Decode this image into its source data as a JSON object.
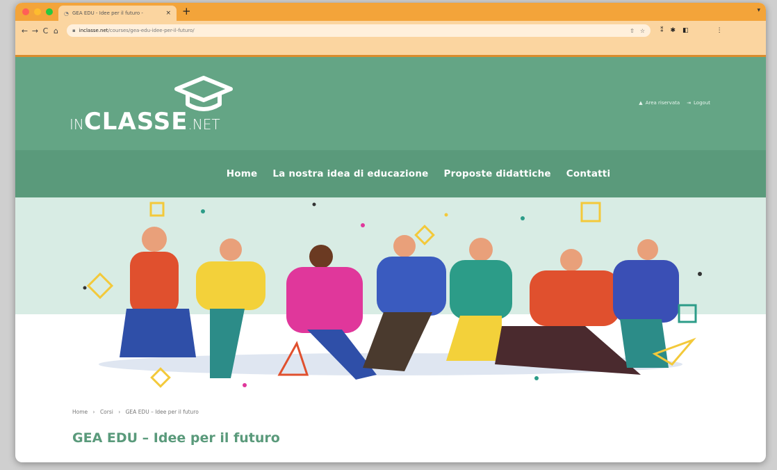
{
  "browser": {
    "tab_title": "GEA EDU - Idee per il futuro -",
    "url_domain": "inclasse.net",
    "url_path": "/courses/gea-edu-idee-per-il-futuro/"
  },
  "icons": {
    "back": "←",
    "forward": "→",
    "reload": "C",
    "home": "⌂",
    "lock": "🔒",
    "close": "×",
    "newtab": "+",
    "user": "👤",
    "logout": "⇥"
  },
  "site": {
    "logo": {
      "prefix": "IN",
      "main": "CLASSE",
      "suffix": "NET"
    },
    "account": {
      "reserved": "Area riservata",
      "logout": "Logout"
    },
    "menu": [
      "Home",
      "La nostra idea di educazione",
      "Proposte didattiche",
      "Contatti"
    ]
  },
  "breadcrumb": [
    "Home",
    "›",
    "Corsi",
    "›",
    "GEA EDU – Idee per il futuro"
  ],
  "page_title": "GEA EDU – Idee per il futuro",
  "colors": {
    "header": "#64a585",
    "menu": "#5a9a7b",
    "browser_tab": "#f3a43a",
    "title": "#5a9a7b"
  }
}
